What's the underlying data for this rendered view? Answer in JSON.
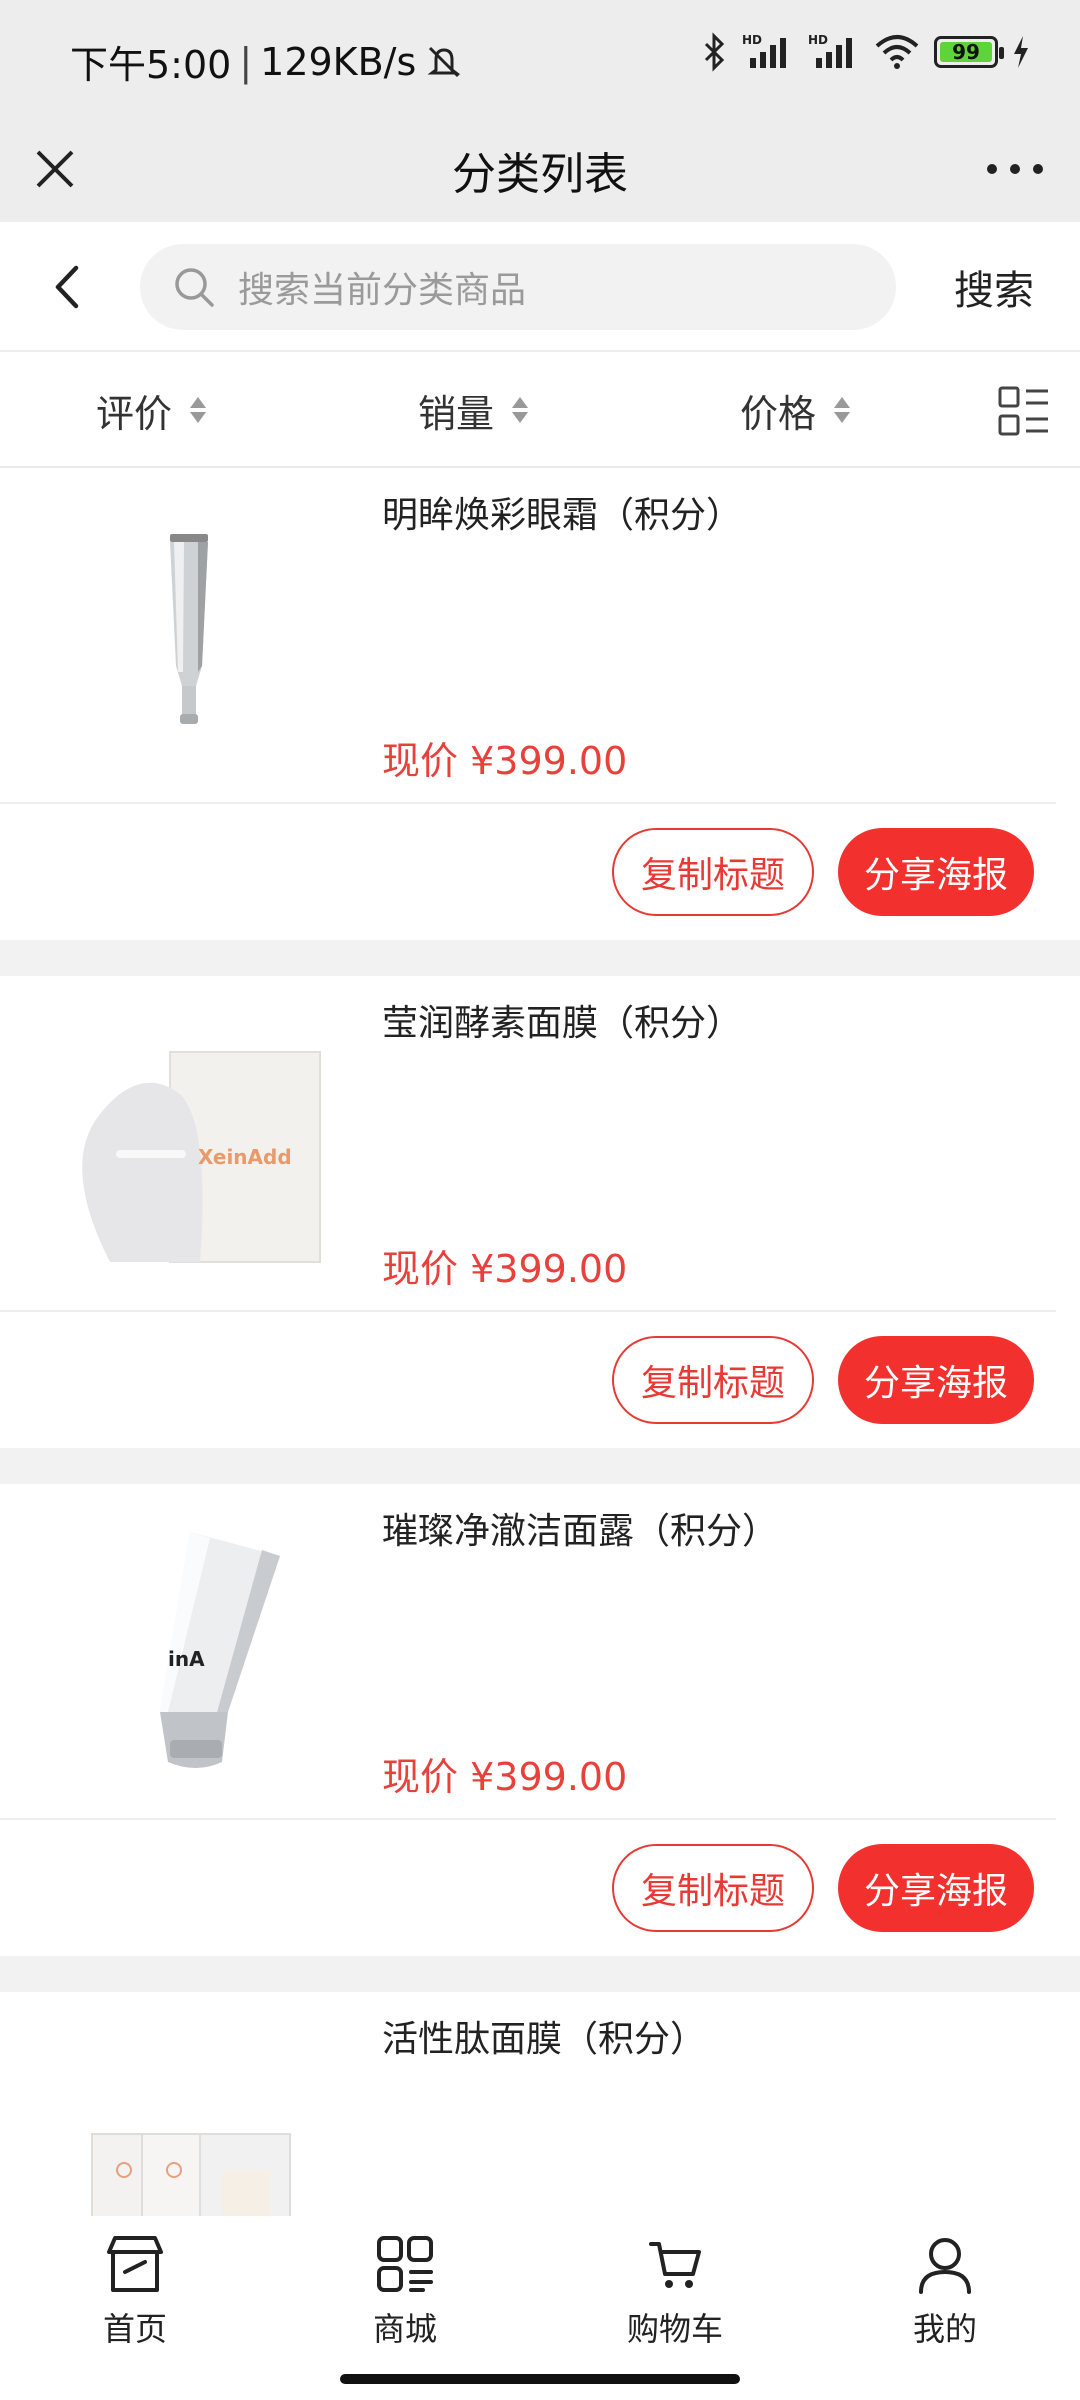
{
  "status_bar": {
    "time": "下午5:00",
    "network_speed": "129KB/s",
    "battery_level": "99",
    "icons": [
      "mute-icon",
      "bluetooth-icon",
      "signal-hd-icon",
      "signal-hd-icon",
      "wifi-icon",
      "battery-icon",
      "charging-icon"
    ]
  },
  "titlebar": {
    "title": "分类列表",
    "close_icon": "close-icon",
    "more_icon": "more-icon"
  },
  "search": {
    "placeholder": "搜索当前分类商品",
    "button": "搜索"
  },
  "sort": {
    "rating": "评价",
    "sales": "销量",
    "price": "价格"
  },
  "products": [
    {
      "name": "明眸焕彩眼霜（积分）",
      "price_prefix": "现价",
      "price": "¥399.00",
      "copy_label": "复制标题",
      "share_label": "分享海报"
    },
    {
      "name": "莹润酵素面膜（积分）",
      "price_prefix": "现价",
      "price": "¥399.00",
      "copy_label": "复制标题",
      "share_label": "分享海报",
      "brand_text": "XeinAdd"
    },
    {
      "name": "璀璨净澈洁面露（积分）",
      "price_prefix": "现价",
      "price": "¥399.00",
      "copy_label": "复制标题",
      "share_label": "分享海报"
    },
    {
      "name": "活性肽面膜（积分）"
    }
  ],
  "tabbar": {
    "home": "首页",
    "mall": "商城",
    "cart": "购物车",
    "mine": "我的"
  },
  "colors": {
    "accent": "#f2312e",
    "price": "#e8403a",
    "header_bg": "#ededed"
  }
}
